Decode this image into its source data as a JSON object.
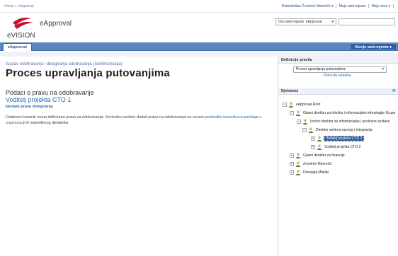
{
  "topbar": {
    "breadcrumb": "Home > eApproval",
    "welcome": "Dobrodošao Zvonimir Mavrečić ▾",
    "sep1": "|",
    "my_site": "Moje web-mjesto",
    "sep2": "|",
    "my_links": "Moje veze ▾",
    "sep3": "|"
  },
  "header": {
    "logo_text": "eVISION",
    "app_title": "eApproval",
    "scope_value": "Ovo web-mjesto: eApproval",
    "colors": {
      "logo_red": "#c8102e",
      "link": "#2b6cb0",
      "tabbar": "#5b86bd"
    }
  },
  "tabs": {
    "active": "eApproval",
    "site_actions": "Akcije web-mjesta ▾"
  },
  "main": {
    "breadcrumb": "Sustav odobravanja i delegiranja odobravanja (Administracija)",
    "title": "Proces upravljanja putovanjima",
    "section": "Podaci o pravu na odobravanje",
    "role": "Voditelj projekta CTO 1",
    "no_rights": "Nemate prava delegiranja",
    "desc_text": "Odabrani korisnik nema definirana prava za odobravanje. Korisniku možete dodati prava na odobravanje na osnovi",
    "desc_link": "prethodka korisnikova položaja u organizaciji",
    "desc_tail": "ili nadređenog djelatnika"
  },
  "right": {
    "definitions_title": "Definicije pravila",
    "definition_value": "Proces upravljanja putovanjima",
    "confirm": "Potvrda odabira",
    "employees_title": "Djelatnici",
    "tree": [
      {
        "label": "eApproval Root",
        "expander": "⊟",
        "level": 0
      },
      {
        "label": "Glavni direktor za tehniku i informacijske tehnologije Grupe",
        "expander": "⊟",
        "level": 1
      },
      {
        "label": "Izvršni direktor za informacijske i poslovne sustave",
        "expander": "⊟",
        "level": 2
      },
      {
        "label": "Direktor sektora razvoja i integracija",
        "expander": "⊟",
        "level": 3
      },
      {
        "label": "Voditelj projekta CTO 1",
        "expander": "⊞",
        "level": 4,
        "selected": true
      },
      {
        "label": "Voditelj projekta CTO 2",
        "expander": "⊞",
        "level": 4
      },
      {
        "label": "Glavni direktor za financije",
        "expander": "⊞",
        "level": 1
      },
      {
        "label": "Zvonimir Mavrečić",
        "expander": "⊞",
        "level": 1
      },
      {
        "label": "Domagoj Milašić",
        "expander": "⊞",
        "level": 1
      }
    ]
  }
}
